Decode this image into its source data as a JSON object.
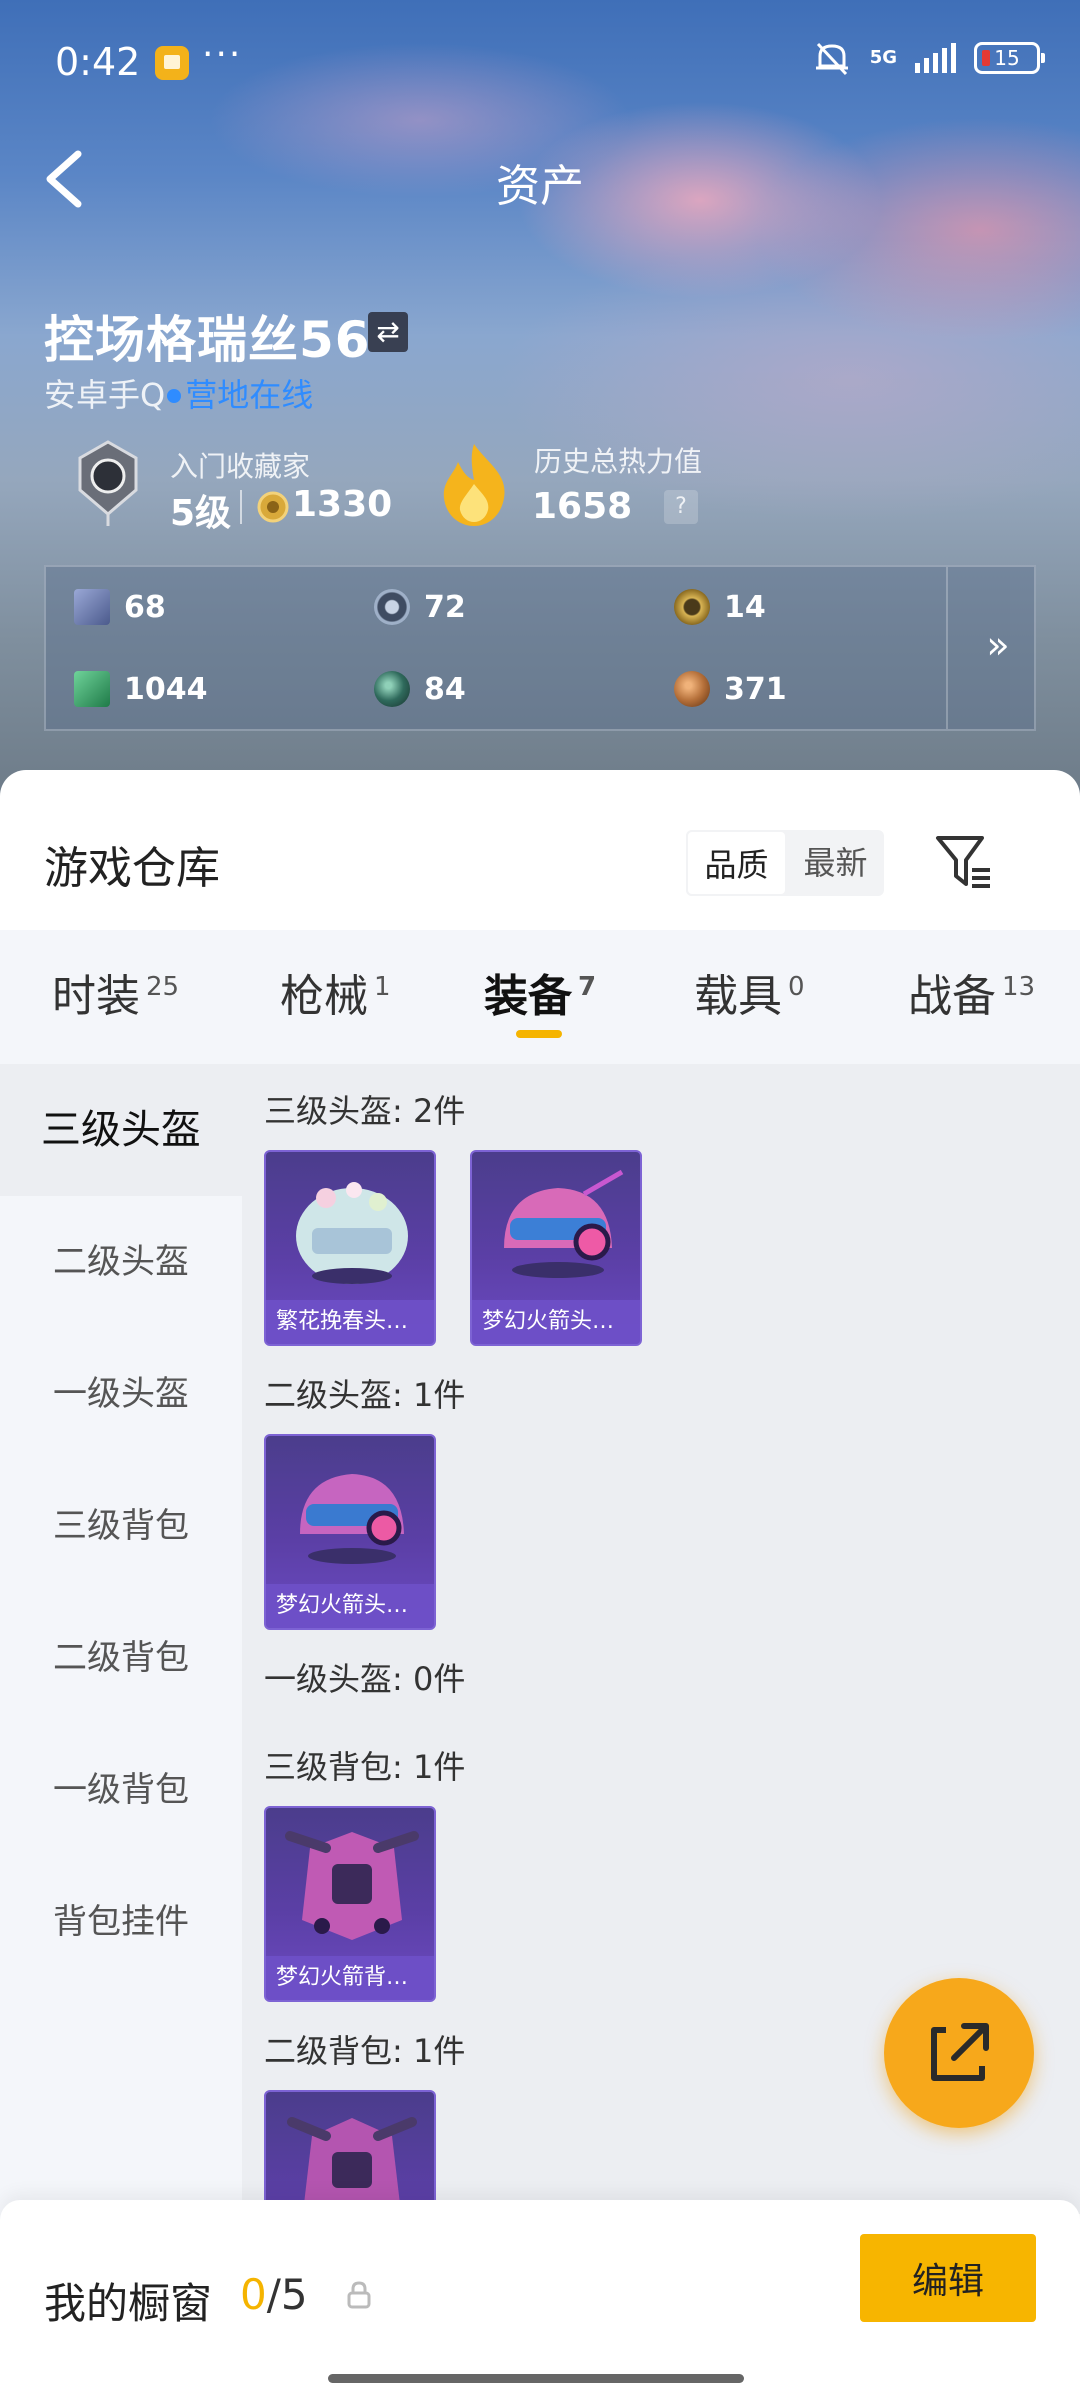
{
  "status_bar": {
    "time": "0:42",
    "dots": "···",
    "network": "5G",
    "battery": "15"
  },
  "header": {
    "title": "资产"
  },
  "player": {
    "name": "控场格瑞丝56",
    "platform": "安卓手Q",
    "status": "营地在线"
  },
  "collector": {
    "title": "入门收藏家",
    "level": "5级",
    "points": "1330"
  },
  "heat": {
    "title": "历史总热力值",
    "value": "1658",
    "help": "?"
  },
  "resources": [
    {
      "icon": "card-icon",
      "value": "68",
      "color": "#8a9ac8"
    },
    {
      "icon": "silver-coin-icon",
      "value": "72",
      "color": "#7f96b5"
    },
    {
      "icon": "gold-badge-icon",
      "value": "14",
      "color": "#c9a54a"
    },
    {
      "icon": "green-ticket-icon",
      "value": "1044",
      "color": "#3fa06a"
    },
    {
      "icon": "green-orb-icon",
      "value": "84",
      "color": "#3d7a6b"
    },
    {
      "icon": "bronze-coin-icon",
      "value": "371",
      "color": "#b5703a"
    }
  ],
  "warehouse": {
    "title": "游戏仓库",
    "sort_options": [
      "品质",
      "最新"
    ],
    "tabs": [
      {
        "label": "时装",
        "count": "25"
      },
      {
        "label": "枪械",
        "count": "1"
      },
      {
        "label": "装备",
        "count": "7"
      },
      {
        "label": "载具",
        "count": "0"
      },
      {
        "label": "战备",
        "count": "13"
      }
    ],
    "categories": [
      "三级头盔",
      "二级头盔",
      "一级头盔",
      "三级背包",
      "二级背包",
      "一级背包",
      "背包挂件"
    ],
    "groups": [
      {
        "title": "三级头盔: 2件",
        "items": [
          "繁花挽春头盔（三级）",
          "梦幻火箭头盔（三级）"
        ]
      },
      {
        "title": "二级头盔: 1件",
        "items": [
          "梦幻火箭头盔（二级）"
        ]
      },
      {
        "title": "一级头盔: 0件",
        "items": []
      },
      {
        "title": "三级背包: 1件",
        "items": [
          "梦幻火箭背包（三级）"
        ]
      },
      {
        "title": "二级背包: 1件",
        "items": [
          ""
        ]
      }
    ]
  },
  "showcase": {
    "label": "我的橱窗",
    "current": "0",
    "separator": "/",
    "max": "5",
    "edit_label": "编辑"
  },
  "colors": {
    "accent": "#f5b400",
    "online": "#2f8cff",
    "card": "#5b3fa6"
  }
}
